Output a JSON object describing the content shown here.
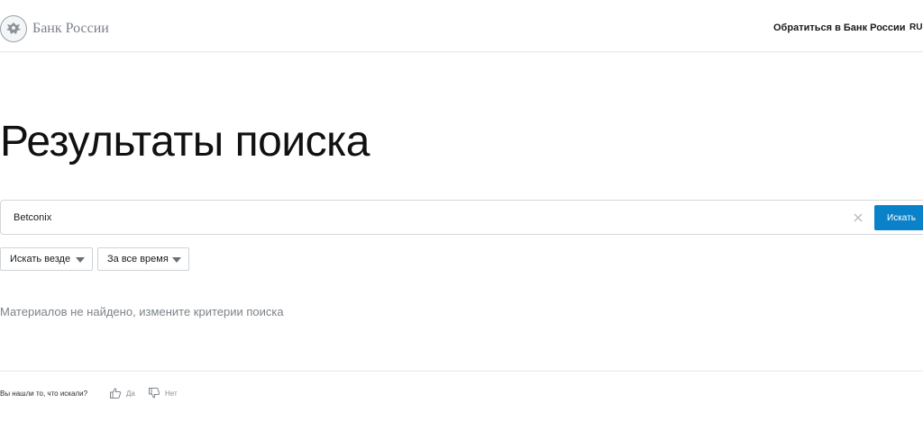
{
  "header": {
    "logo_text": "Банк России",
    "contact_link": "Обратиться в Банк России",
    "language": "RU"
  },
  "page": {
    "title": "Результаты поиска"
  },
  "search": {
    "value": "Betconix",
    "button_label": "Искать"
  },
  "filters": {
    "where": "Искать везде",
    "time": "За все время"
  },
  "results": {
    "empty_message": "Материалов не найдено, измените критерии поиска"
  },
  "feedback": {
    "question": "Вы нашли то, что искали?",
    "yes": "Да",
    "no": "Нет"
  },
  "colors": {
    "accent": "#0a82c9",
    "muted_text": "#7d8388"
  },
  "icons": {
    "logo": "bank-eagle-emblem-icon",
    "clear": "close-icon",
    "caret": "chevron-down-icon",
    "like": "thumbs-up-icon",
    "dislike": "thumbs-down-icon"
  }
}
